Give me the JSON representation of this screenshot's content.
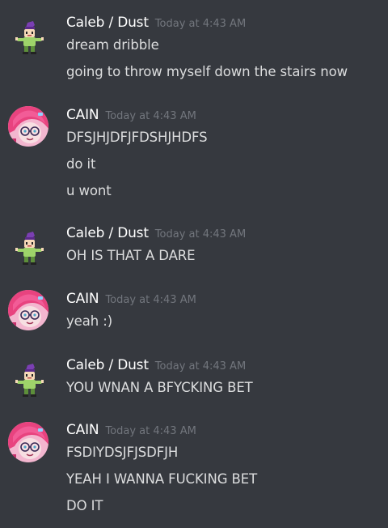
{
  "groups": [
    {
      "author": "Caleb / Dust",
      "timestamp": "Today at 4:43 AM",
      "avatar": "dust-sprite-icon",
      "messages": [
        "dream dribble",
        "going to throw myself down the stairs now"
      ]
    },
    {
      "author": "CAIN",
      "timestamp": "Today at 4:43 AM",
      "avatar": "cain-pink-hair-avatar",
      "messages": [
        "DFSJHJDFJFDSHJHDFS",
        "do it",
        "u wont"
      ]
    },
    {
      "author": "Caleb / Dust",
      "timestamp": "Today at 4:43 AM",
      "avatar": "dust-sprite-icon",
      "messages": [
        "OH IS THAT A DARE"
      ]
    },
    {
      "author": "CAIN",
      "timestamp": "Today at 4:43 AM",
      "avatar": "cain-pink-hair-avatar",
      "messages": [
        "yeah :)"
      ]
    },
    {
      "author": "Caleb / Dust",
      "timestamp": "Today at 4:43 AM",
      "avatar": "dust-sprite-icon",
      "messages": [
        "YOU WNAN A BFYCKING BET"
      ]
    },
    {
      "author": "CAIN",
      "timestamp": "Today at 4:43 AM",
      "avatar": "cain-pink-hair-avatar",
      "messages": [
        "FSDIYDSJFJSDFJH",
        "YEAH I WANNA FUCKING BET",
        "DO IT"
      ]
    }
  ],
  "colors": {
    "background": "#36393f",
    "username": "#ffffff",
    "timestamp": "#72767d",
    "message": "#dcddde"
  }
}
